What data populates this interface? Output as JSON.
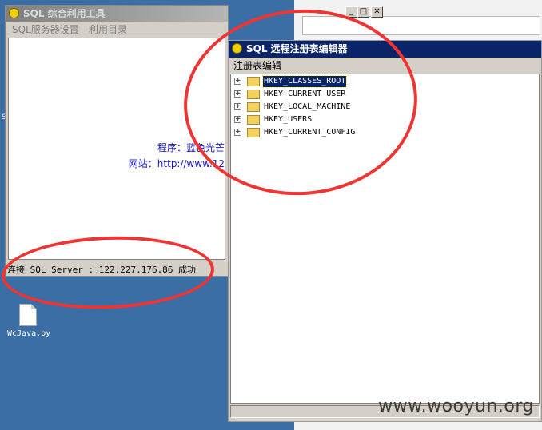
{
  "main_window": {
    "title": "SQL 综合利用工具",
    "menu": [
      "SQL服务器设置",
      "利用目录"
    ],
    "content_line1": "程序：蓝色光芒",
    "content_line2": "网站：http://www.12",
    "status": "连接 SQL Server : 122.227.176.86 成功"
  },
  "registry_window": {
    "title": "SQL 远程注册表编辑器",
    "menu": [
      "注册表编辑"
    ],
    "tree": [
      {
        "label": "HKEY_CLASSES_ROOT",
        "selected": true
      },
      {
        "label": "HKEY_CURRENT_USER",
        "selected": false
      },
      {
        "label": "HKEY_LOCAL_MACHINE",
        "selected": false
      },
      {
        "label": "HKEY_USERS",
        "selected": false
      },
      {
        "label": "HKEY_CURRENT_CONFIG",
        "selected": false
      }
    ],
    "expander_glyph": "+"
  },
  "desktop": {
    "file_label": "WcJava.py",
    "edge_letter": "S"
  },
  "title_buttons": {
    "minimize": "_",
    "maximize": "□",
    "close": "✕"
  },
  "watermark": "www.wooyun.org",
  "colors": {
    "annotation_red": "#ef3434",
    "active_title": "#0a246a",
    "desktop": "#3a6ea5",
    "link_blue": "#1b1bd0"
  }
}
